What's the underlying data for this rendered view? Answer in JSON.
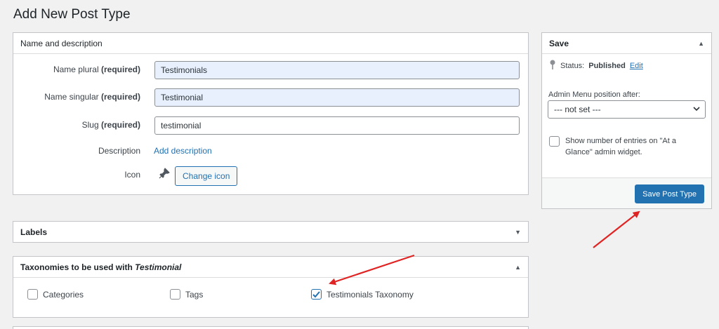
{
  "page": {
    "title": "Add New Post Type"
  },
  "name_box": {
    "header": "Name and description",
    "plural_label": "Name plural",
    "plural_value": "Testimonials",
    "singular_label": "Name singular",
    "singular_value": "Testimonial",
    "slug_label": "Slug",
    "slug_value": "testimonial",
    "required_text": "(required)",
    "description_label": "Description",
    "description_link": "Add description",
    "icon_label": "Icon",
    "change_icon_label": "Change icon"
  },
  "labels_box": {
    "header": "Labels"
  },
  "taxonomies_box": {
    "header_prefix": "Taxonomies to be used with",
    "header_emphasis": "Testimonial",
    "items": [
      {
        "label": "Categories",
        "checked": false
      },
      {
        "label": "Tags",
        "checked": false
      },
      {
        "label": "Testimonials Taxonomy",
        "checked": true
      }
    ]
  },
  "save_box": {
    "header": "Save",
    "status_label": "Status:",
    "status_value": "Published",
    "edit_link": "Edit",
    "menu_position_label": "Admin Menu position after:",
    "menu_position_value": "--- not set ---",
    "glance_label": "Show number of entries on \"At a Glance\" admin widget.",
    "glance_checked": false,
    "save_button": "Save Post Type"
  },
  "colors": {
    "accent": "#2271b1",
    "arrow": "#e02424"
  },
  "icons": {
    "pin": "pin-icon",
    "pushpin": "pushpin-icon",
    "toggle_down": "triangle-down-icon",
    "toggle_up": "triangle-up-icon"
  }
}
